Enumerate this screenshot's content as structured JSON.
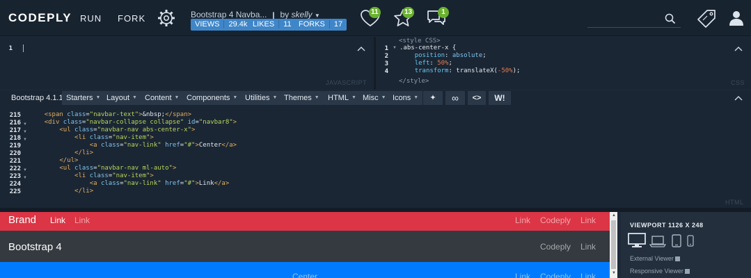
{
  "header": {
    "logo": "CODEPLY",
    "run": "RUN",
    "fork": "FORK",
    "project_title": "Bootstrap 4 Navba...",
    "by": "by",
    "author": "skelly",
    "stats": [
      {
        "label": "VIEWS",
        "value": "29.4k"
      },
      {
        "label": "LIKES",
        "value": "11"
      },
      {
        "label": "FORKS",
        "value": "17"
      }
    ],
    "likes_badge": "11",
    "stars_badge": "13",
    "comments_badge": "1",
    "search_placeholder": ""
  },
  "js_pane": {
    "line": "1",
    "label": "JAVASCRIPT"
  },
  "css_pane": {
    "label": "CSS",
    "open_tag": "<style CSS>",
    "close_tag": "</style>",
    "lines": [
      {
        "n": "1",
        "text": ".abs-center-x {"
      },
      {
        "n": "2",
        "text": "    position: absolute;"
      },
      {
        "n": "3",
        "text": "    left: 50%;"
      },
      {
        "n": "4",
        "text": "    transform: translateX(-50%);"
      }
    ]
  },
  "toolbar": {
    "items": [
      "Bootstrap 4.1.1",
      "Starters",
      "Layout",
      "Content",
      "Components",
      "Utilities",
      "Themes",
      "HTML",
      "Misc",
      "Icons"
    ],
    "w_button": "W!"
  },
  "html_pane": {
    "label": "HTML",
    "lines": [
      {
        "n": "215",
        "text": "    <span class=\"navbar-text\">&nbsp;</span>"
      },
      {
        "n": "216",
        "text": "    <div class=\"navbar-collapse collapse\" id=\"navbar8\">"
      },
      {
        "n": "217",
        "text": "        <ul class=\"navbar-nav abs-center-x\">"
      },
      {
        "n": "218",
        "text": "            <li class=\"nav-item\">"
      },
      {
        "n": "219",
        "text": "                <a class=\"nav-link\" href=\"#\">Center</a>"
      },
      {
        "n": "220",
        "text": "            </li>"
      },
      {
        "n": "221",
        "text": "        </ul>"
      },
      {
        "n": "222",
        "text": "        <ul class=\"navbar-nav ml-auto\">"
      },
      {
        "n": "223",
        "text": "            <li class=\"nav-item\">"
      },
      {
        "n": "224",
        "text": "                <a class=\"nav-link\" href=\"#\">Link</a>"
      },
      {
        "n": "225",
        "text": "            </li>"
      }
    ]
  },
  "preview": {
    "nav1": {
      "brand": "Brand",
      "left_links": [
        "Link",
        "Link"
      ],
      "right_links": [
        "Link",
        "Codeply",
        "Link"
      ],
      "bg": "#dc3545"
    },
    "nav2": {
      "brand": "Bootstrap 4",
      "right_links": [
        "Codeply",
        "Link"
      ],
      "bg": "#343a40"
    },
    "nav3": {
      "center": "Center",
      "right_links": [
        "Link",
        "Codeply",
        "Link"
      ],
      "bg": "#007bff"
    }
  },
  "viewport": {
    "title": "VIEWPORT 1126 X 248",
    "external": "External Viewer",
    "responsive": "Responsive Viewer"
  }
}
